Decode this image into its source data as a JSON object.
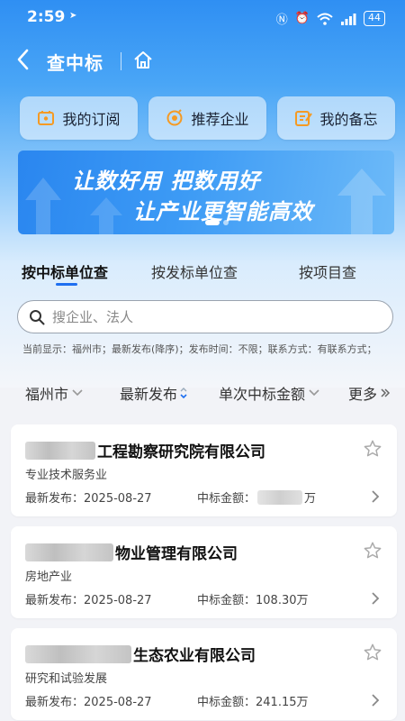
{
  "status_bar": {
    "time": "2:59",
    "battery": "44"
  },
  "nav": {
    "title": "查中标"
  },
  "quick_actions": [
    {
      "label": "我的订阅",
      "icon": "subscription-icon"
    },
    {
      "label": "推荐企业",
      "icon": "recommend-icon"
    },
    {
      "label": "我的备忘",
      "icon": "memo-icon"
    }
  ],
  "banner": {
    "line1": "让数好用 把数用好",
    "line2": "让产业更智能高效"
  },
  "tabs": [
    {
      "label": "按中标单位查",
      "active": true
    },
    {
      "label": "按发标单位查",
      "active": false
    },
    {
      "label": "按项目查",
      "active": false
    }
  ],
  "search": {
    "placeholder": "搜企业、法人"
  },
  "filter_summary": "当前显示：福州市；最新发布(降序)；发布时间：不限；联系方式：有联系方式；",
  "filters": {
    "city": "福州市",
    "sort": "最新发布",
    "amount": "单次中标金额",
    "more": "更多"
  },
  "results": [
    {
      "name_suffix": "工程勘察研究院有限公司",
      "industry": "专业技术服务业",
      "date_label": "最新发布：",
      "date": "2025-08-27",
      "amount_label": "中标金额：",
      "amount": "",
      "amount_unit": "万"
    },
    {
      "name_suffix": "物业管理有限公司",
      "industry": "房地产业",
      "date_label": "最新发布：",
      "date": "2025-08-27",
      "amount_label": "中标金额：",
      "amount": "108.30万",
      "amount_unit": ""
    },
    {
      "name_suffix": "生态农业有限公司",
      "industry": "研究和试验发展",
      "date_label": "最新发布：",
      "date": "2025-08-27",
      "amount_label": "中标金额：",
      "amount": "241.15万",
      "amount_unit": ""
    }
  ],
  "colors": {
    "primary": "#1e6ff0",
    "header_gradient_top": "#2f8ff3"
  }
}
